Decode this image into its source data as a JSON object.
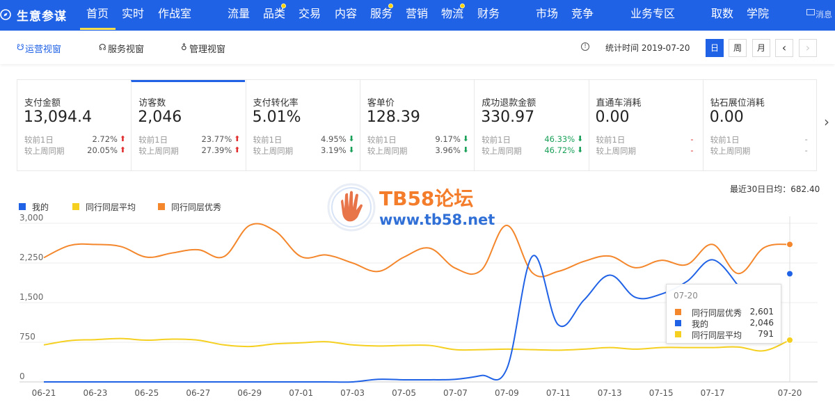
{
  "brand": {
    "name": "生意参谋"
  },
  "nav": {
    "items": [
      {
        "label": "首页",
        "active": true
      },
      {
        "label": "实时"
      },
      {
        "label": "作战室"
      },
      {
        "label": "流量"
      },
      {
        "label": "品类",
        "dot": true
      },
      {
        "label": "交易"
      },
      {
        "label": "内容"
      },
      {
        "label": "服务",
        "dot": true
      },
      {
        "label": "营销"
      },
      {
        "label": "物流",
        "dot": true
      },
      {
        "label": "财务"
      },
      {
        "label": "市场"
      },
      {
        "label": "竞争"
      },
      {
        "label": "业务专区"
      },
      {
        "label": "取数"
      },
      {
        "label": "学院"
      }
    ],
    "message_label": "消息"
  },
  "subbar": {
    "tabs": [
      {
        "label": "运营视窗",
        "active": true
      },
      {
        "label": "服务视窗"
      },
      {
        "label": "管理视窗"
      }
    ],
    "stat_time": "统计时间 2019-07-20",
    "period_buttons": [
      "日",
      "周",
      "月"
    ],
    "prev": "‹",
    "next": "›"
  },
  "metrics": [
    {
      "name": "支付金额",
      "value": "13,094.4",
      "d1_label": "较前1日",
      "d1": "2.72%",
      "d1_dir": "up",
      "w_label": "较上周同期",
      "w": "20.05%",
      "w_dir": "up"
    },
    {
      "name": "访客数",
      "value": "2,046",
      "selected": true,
      "d1_label": "较前1日",
      "d1": "23.77%",
      "d1_dir": "up",
      "w_label": "较上周同期",
      "w": "27.39%",
      "w_dir": "up"
    },
    {
      "name": "支付转化率",
      "value": "5.01%",
      "d1_label": "较前1日",
      "d1": "4.95%",
      "d1_dir": "down",
      "w_label": "较上周同期",
      "w": "3.19%",
      "w_dir": "down"
    },
    {
      "name": "客单价",
      "value": "128.39",
      "d1_label": "较前1日",
      "d1": "9.17%",
      "d1_dir": "down",
      "w_label": "较上周同期",
      "w": "3.96%",
      "w_dir": "down"
    },
    {
      "name": "成功退款金额",
      "value": "330.97",
      "d1_label": "较前1日",
      "d1": "46.33%",
      "d1_dir": "down",
      "w_label": "较上周同期",
      "w": "46.72%",
      "w_dir": "down"
    },
    {
      "name": "直通车消耗",
      "value": "0.00",
      "d1_label": "较前1日",
      "d1": "-",
      "d1_dir": "none-red",
      "w_label": "较上周同期",
      "w": "-",
      "w_dir": "none-red"
    },
    {
      "name": "钻石展位消耗",
      "value": "0.00",
      "d1_label": "较前1日",
      "d1": "-",
      "d1_dir": "none",
      "w_label": "较上周同期",
      "w": "-",
      "w_dir": "none"
    }
  ],
  "chart_header": {
    "avg": "最近30日日均：682.40"
  },
  "watermark": {
    "line1": "TB58论坛",
    "line2": "www.tb58.net"
  },
  "tooltip": {
    "title": "07-20",
    "rows": [
      {
        "name": "同行同层优秀",
        "value": "2,601",
        "color": "#f4862b"
      },
      {
        "name": "我的",
        "value": "2,046",
        "color": "#2062e6"
      },
      {
        "name": "同行同层平均",
        "value": "791",
        "color": "#f5d020"
      }
    ]
  },
  "chart_data": {
    "type": "line",
    "categories": [
      "06-21",
      "06-22",
      "06-23",
      "06-24",
      "06-25",
      "06-26",
      "06-27",
      "06-28",
      "06-29",
      "06-30",
      "07-01",
      "07-02",
      "07-03",
      "07-04",
      "07-05",
      "07-06",
      "07-07",
      "07-08",
      "07-09",
      "07-10",
      "07-11",
      "07-12",
      "07-13",
      "07-14",
      "07-15",
      "07-16",
      "07-17",
      "07-18",
      "07-19",
      "07-20"
    ],
    "xticks": [
      "06-21",
      "06-23",
      "06-25",
      "06-27",
      "06-29",
      "07-01",
      "07-03",
      "07-05",
      "07-07",
      "07-09",
      "07-11",
      "07-13",
      "07-15",
      "07-17",
      "07-20"
    ],
    "yticks": [
      0,
      750,
      1500,
      2250,
      3000
    ],
    "ytick_labels": [
      "0",
      "750",
      "1,500",
      "2,250",
      "3,000"
    ],
    "ylim": [
      0,
      3000
    ],
    "series": [
      {
        "name": "我的",
        "color": "#2062e6",
        "values": [
          0,
          0,
          0,
          0,
          0,
          0,
          0,
          0,
          0,
          0,
          0,
          0,
          0,
          50,
          40,
          40,
          50,
          120,
          250,
          2380,
          1080,
          1550,
          2020,
          1600,
          1660,
          1900,
          2310,
          1820,
          null,
          2046
        ]
      },
      {
        "name": "同行同层平均",
        "color": "#f5d020",
        "values": [
          700,
          780,
          800,
          820,
          790,
          810,
          790,
          700,
          670,
          720,
          740,
          760,
          700,
          680,
          690,
          690,
          610,
          610,
          620,
          610,
          600,
          620,
          650,
          620,
          650,
          650,
          650,
          660,
          590,
          791
        ]
      },
      {
        "name": "同行同层优秀",
        "color": "#f4862b",
        "values": [
          2350,
          2580,
          2600,
          2560,
          2360,
          2440,
          2500,
          2370,
          2960,
          2850,
          2370,
          2400,
          2250,
          2090,
          2360,
          2530,
          2150,
          2110,
          2960,
          2060,
          2090,
          2280,
          2380,
          2160,
          2300,
          2220,
          2600,
          2050,
          2540,
          2601
        ]
      }
    ]
  }
}
